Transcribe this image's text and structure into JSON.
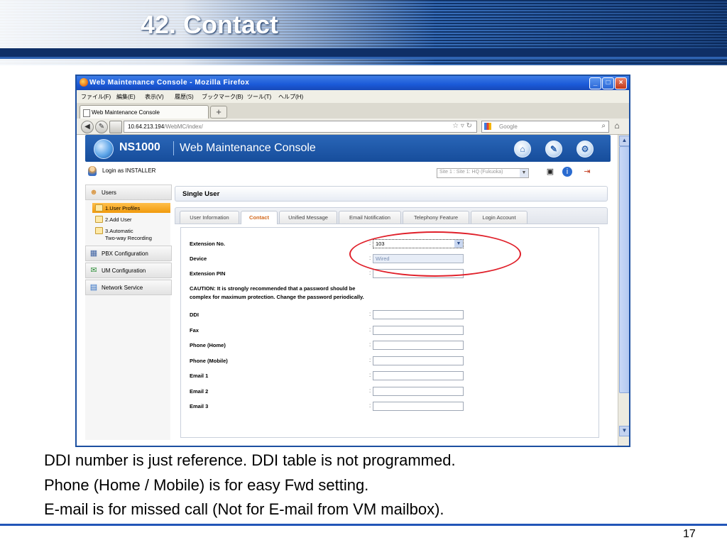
{
  "slide": {
    "title": "42. Contact",
    "notes": [
      "DDI number is just reference. DDI table is not programmed.",
      "Phone (Home / Mobile) is for easy Fwd setting.",
      "E-mail is for missed call (Not for E-mail from VM mailbox)."
    ],
    "page_number": "17"
  },
  "browser": {
    "window_title": "Web Maintenance Console - Mozilla Firefox",
    "menu": [
      "ファイル(F)",
      "編集(E)",
      "表示(V)",
      "履歴(S)",
      "ブックマーク(B)",
      "ツール(T)",
      "ヘルプ(H)"
    ],
    "tab_label": "Web Maintenance Console",
    "url_host": "10.64.213.194",
    "url_path": "/WebMC/index/",
    "search_placeholder": "Google"
  },
  "app": {
    "brand": "NS1000",
    "name": "Web Maintenance Console",
    "login_text": "Login as INSTALLER",
    "site_select": "Site 1 : Site 1: HQ (Fukuoka)"
  },
  "sidebar": {
    "groups": [
      {
        "label": "Users",
        "icon": "users-icon"
      },
      {
        "label": "PBX Configuration",
        "icon": "pbx-icon"
      },
      {
        "label": "UM Configuration",
        "icon": "um-icon"
      },
      {
        "label": "Network Service",
        "icon": "network-icon"
      }
    ],
    "user_items": [
      "1.User Profiles",
      "2.Add User",
      "3.Automatic",
      "Two-way Recording"
    ]
  },
  "panel": {
    "title": "Single User",
    "tabs": [
      "User Information",
      "Contact",
      "Unified Message",
      "Email Notification",
      "Telephony Feature",
      "Login Account"
    ],
    "active_tab": "Contact"
  },
  "form": {
    "extension_label": "Extension No.",
    "extension_value": "103",
    "device_label": "Device",
    "device_value": "Wired",
    "pin_label": "Extension PIN",
    "caution": "CAUTION: It is strongly recommended that a password should be complex for maximum protection. Change the password periodically.",
    "fields": [
      "DDI",
      "Fax",
      "Phone (Home)",
      "Phone (Mobile)",
      "Email 1",
      "Email 2",
      "Email 3"
    ],
    "colon": ":"
  },
  "colors": {
    "header_blue": "#164d9b",
    "active_tab_text": "#d2691e",
    "highlight_ellipse": "#e0202a",
    "sidebar_active": "#f19a0d"
  }
}
